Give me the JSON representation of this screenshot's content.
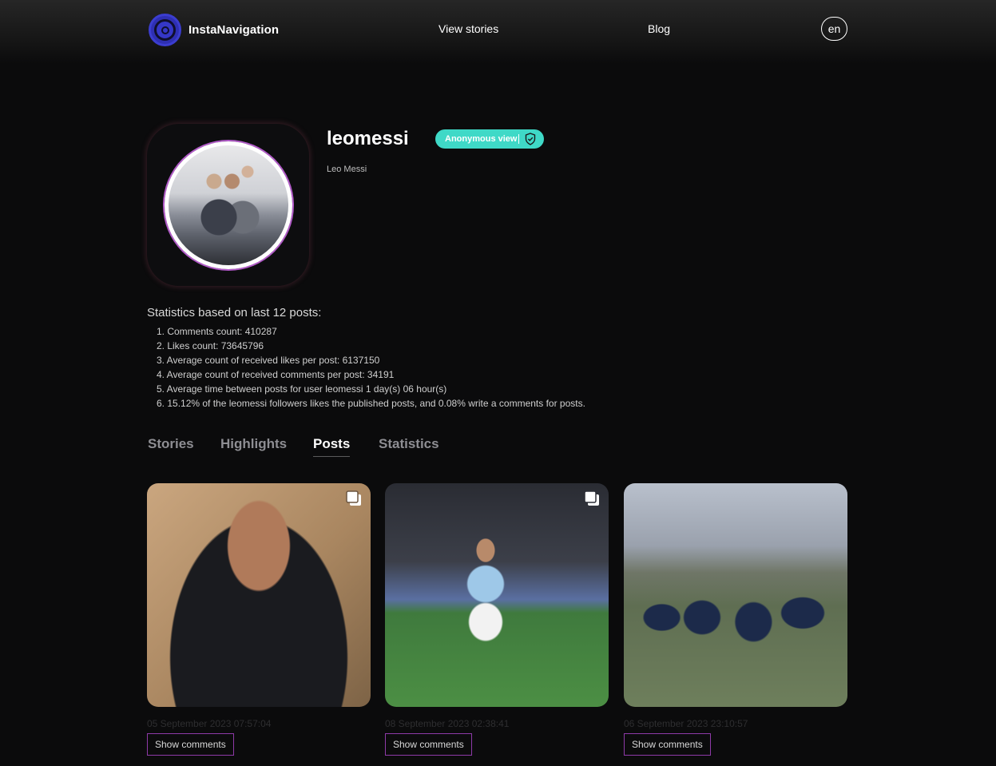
{
  "header": {
    "brand": "InstaNavigation",
    "nav": {
      "stories": "View stories",
      "blog": "Blog"
    },
    "language": "en"
  },
  "profile": {
    "username": "leomessi",
    "badge": "Anonymous view",
    "full_name": "Leo Messi"
  },
  "statistics": {
    "title": "Statistics based on last 12 posts:",
    "items": [
      "1. Comments count: 410287",
      "2. Likes count: 73645796",
      "3. Average count of received likes per post: 6137150",
      "4. Average count of received comments per post: 34191",
      "5. Average time between posts for user leomessi 1 day(s) 06 hour(s)",
      "6. 15.12% of the leomessi followers likes the published posts, and 0.08% write a comments for posts."
    ]
  },
  "tabs": {
    "stories": "Stories",
    "highlights": "Highlights",
    "posts": "Posts",
    "statistics": "Statistics",
    "active": "posts"
  },
  "posts": [
    {
      "date": "05 September 2023 07:57:04",
      "button": "Show comments",
      "multi": true
    },
    {
      "date": "08 September 2023 02:38:41",
      "button": "Show comments",
      "multi": true
    },
    {
      "date": "06 September 2023 23:10:57",
      "button": "Show comments",
      "multi": false
    }
  ],
  "colors": {
    "badge": "#3fd9c7",
    "logo": "#2e2fb3",
    "button_border": "#8e3aa8"
  }
}
